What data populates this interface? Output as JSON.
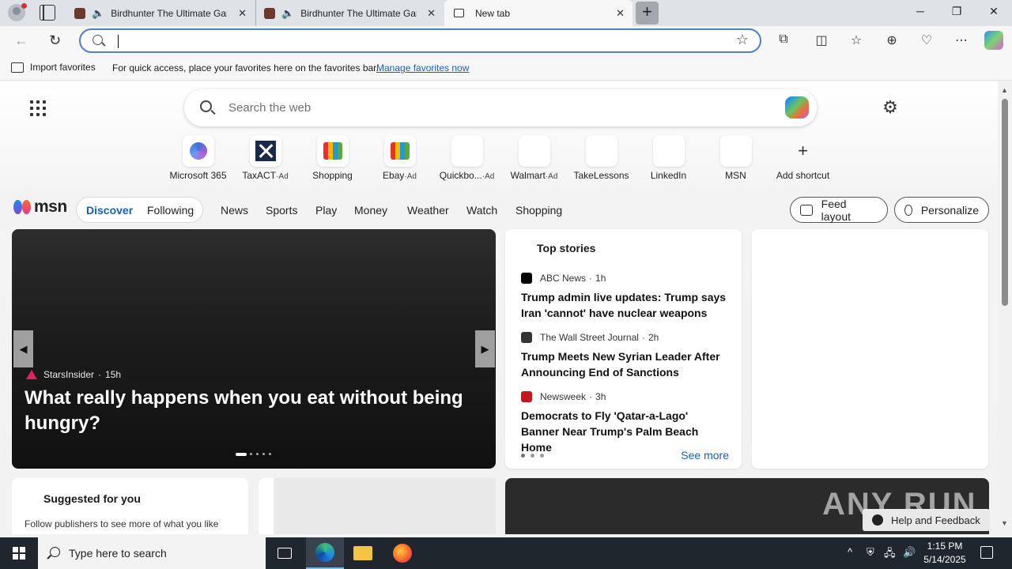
{
  "browser": {
    "tabs": [
      {
        "title": "Birdhunter The Ultimate Gar",
        "audio": true,
        "active": false
      },
      {
        "title": "Birdhunter The Ultimate Gar",
        "audio": true,
        "active": false
      },
      {
        "title": "New tab",
        "audio": false,
        "active": true
      }
    ],
    "new_tab_symbol": "+",
    "window_controls": {
      "minimize": "─",
      "restore": "❐",
      "close": "✕"
    },
    "address": {
      "value": ""
    },
    "toolbar_icons": [
      "extensions-icon",
      "split-screen-icon",
      "favorites-icon",
      "collections-icon",
      "browser-essentials-icon",
      "more-icon",
      "copilot-icon"
    ]
  },
  "favorites_bar": {
    "import_label": "Import favorites",
    "hint": "For quick access, place your favorites here on the favorites bar.",
    "manage_link": "Manage favorites now"
  },
  "newtab": {
    "search_placeholder": "Search the web",
    "shortcuts": [
      {
        "label": "Microsoft 365",
        "ad": ""
      },
      {
        "label": "TaxACT",
        "ad": "·Ad"
      },
      {
        "label": "Shopping",
        "ad": ""
      },
      {
        "label": "Ebay",
        "ad": "·Ad"
      },
      {
        "label": "Quickbo...",
        "ad": "·Ad"
      },
      {
        "label": "Walmart",
        "ad": "·Ad"
      },
      {
        "label": "TakeLessons",
        "ad": ""
      },
      {
        "label": "LinkedIn",
        "ad": ""
      },
      {
        "label": "MSN",
        "ad": ""
      },
      {
        "label": "Add shortcut",
        "ad": ""
      }
    ]
  },
  "msn": {
    "logo_text": "msn",
    "discover": "Discover",
    "following": "Following",
    "nav": [
      "News",
      "Sports",
      "Play",
      "Money",
      "Weather",
      "Watch",
      "Shopping"
    ],
    "feed_layout": "Feed layout",
    "personalize": "Personalize"
  },
  "hero": {
    "source": "StarsInsider",
    "age": "15h",
    "headline": "What really happens when you eat without being hungry?"
  },
  "top_stories": {
    "heading": "Top stories",
    "items": [
      {
        "source": "ABC News",
        "age": "1h",
        "title": "Trump admin live updates: Trump says Iran 'cannot' have nuclear weapons",
        "color": "#000000"
      },
      {
        "source": "The Wall Street Journal",
        "age": "2h",
        "title": "Trump Meets New Syrian Leader After Announcing End of Sanctions",
        "color": "#333333"
      },
      {
        "source": "Newsweek",
        "age": "3h",
        "title": "Democrats to Fly 'Qatar-a-Lago' Banner Near Trump's Palm Beach Home",
        "color": "#c4161c"
      }
    ],
    "see_more": "See more"
  },
  "suggested": {
    "title": "Suggested for you",
    "desc": "Follow publishers to see more of what you like"
  },
  "help_feedback": "Help and Feedback",
  "taskbar": {
    "search_placeholder": "Type here to search",
    "time": "1:15 PM",
    "date": "5/14/2025"
  }
}
